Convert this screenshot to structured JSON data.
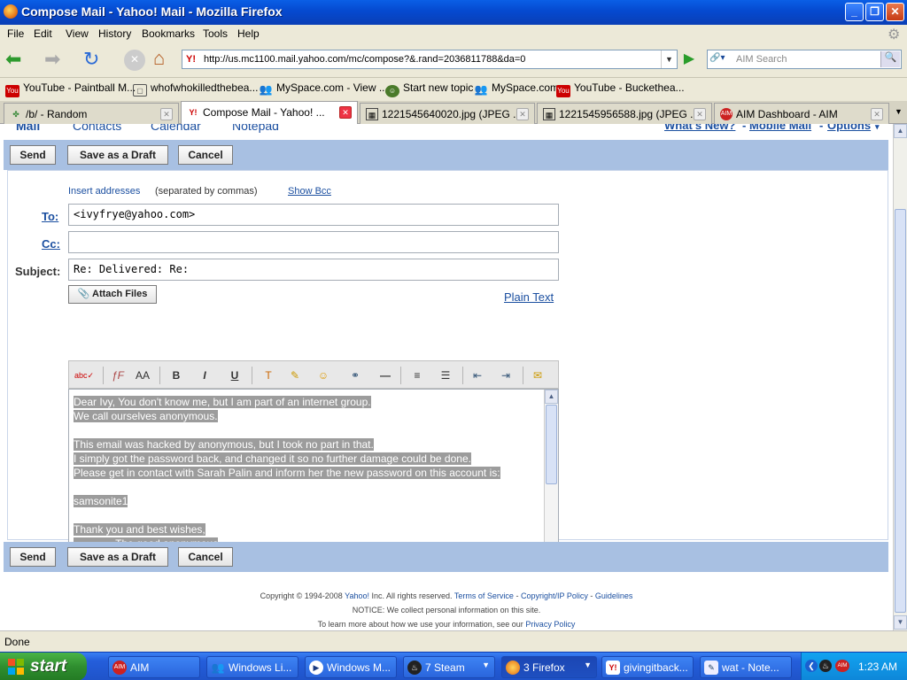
{
  "window": {
    "title": "Compose Mail - Yahoo! Mail - Mozilla Firefox"
  },
  "menu": [
    "File",
    "Edit",
    "View",
    "History",
    "Bookmarks",
    "Tools",
    "Help"
  ],
  "nav": {
    "url": "http://us.mc1100.mail.yahoo.com/mc/compose?&.rand=2036811788&da=0",
    "search_placeholder": "AIM Search"
  },
  "bookmarks": [
    "YouTube - Paintball M...",
    "whofwhokilledthebea...",
    "MySpace.com - View ...",
    "Start new topic",
    "MySpace.com",
    "YouTube - Buckethea..."
  ],
  "tabs": [
    "/b/ - Random",
    "Compose Mail - Yahoo! ...",
    "1221545640020.jpg (JPEG ...",
    "1221545956588.jpg (JPEG ...",
    "AIM Dashboard - AIM"
  ],
  "topnav": {
    "mail": "Mail",
    "contacts": "Contacts",
    "calendar": "Calendar",
    "notepad": "Notepad",
    "whats_new": "What's New?",
    "mobile": "Mobile Mail",
    "options": "Options",
    "sep": "-"
  },
  "actions": {
    "send": "Send",
    "draft": "Save as a Draft",
    "cancel": "Cancel"
  },
  "compose": {
    "insert_addresses": "Insert addresses",
    "separated": "(separated by commas)",
    "show_bcc": "Show Bcc",
    "to_label": "To:",
    "to_value": "<ivyfrye@yahoo.com>",
    "cc_label": "Cc:",
    "cc_value": "",
    "subject_label": "Subject:",
    "subject_value": "Re: Delivered: Re:",
    "attach": "Attach Files",
    "plain_text": "Plain Text"
  },
  "body_lines": [
    "Dear Ivy, You don't know me, but I am part of an internet group.",
    "We call ourselves anonymous.",
    "",
    "This email was hacked by anonymous, but I took no part in that.",
    "I simply got the password back, and changed it so no further damage could be done.",
    "Please get in contact with Sarah Palin and inform her the new password on this account is:",
    "",
    "samsonite1",
    "",
    "Thank you and best wishes,",
    "            - The good anonymous"
  ],
  "footer": {
    "copyright": "Copyright © 1994-2008",
    "yahoo": "Yahoo!",
    "rights": "Inc. All rights reserved.",
    "tos": "Terms of Service",
    "dash": "-",
    "copyright_ip": "Copyright/IP Policy",
    "guidelines": "Guidelines",
    "notice": "NOTICE: We collect personal information on this site.",
    "learn": "To learn more about how we use your information, see our",
    "privacy": "Privacy Policy"
  },
  "status": "Done",
  "taskbar": {
    "start": "start",
    "items": [
      "AIM",
      "Windows Li...",
      "Windows M...",
      "7 Steam",
      "3 Firefox",
      "givingitback...",
      "wat - Note..."
    ],
    "clock": "1:23 AM"
  }
}
